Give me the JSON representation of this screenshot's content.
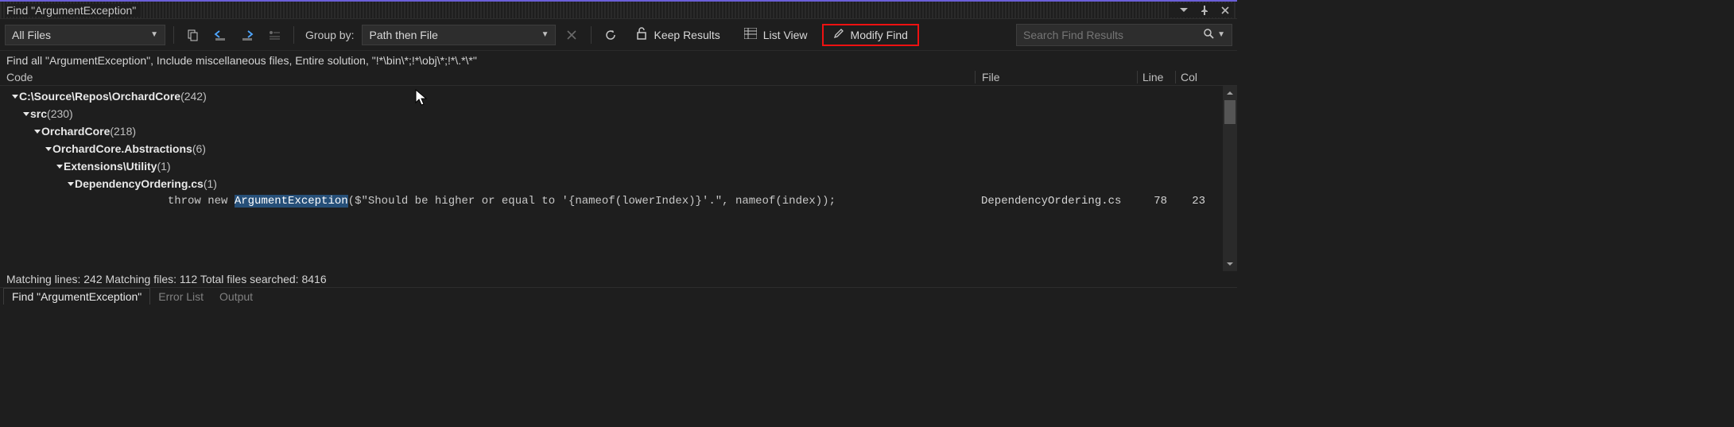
{
  "title": "Find \"ArgumentException\"",
  "toolbar": {
    "scope_selected": "All Files",
    "group_by_label": "Group by:",
    "group_by_selected": "Path then File",
    "keep_results": "Keep Results",
    "list_view": "List View",
    "modify_find": "Modify Find",
    "search_placeholder": "Search Find Results"
  },
  "query_summary": "Find all \"ArgumentException\", Include miscellaneous files, Entire solution, \"!*\\bin\\*;!*\\obj\\*;!*\\.*\\*\"",
  "columns": {
    "code": "Code",
    "file": "File",
    "line": "Line",
    "col": "Col"
  },
  "tree": [
    {
      "depth": 0,
      "label": "C:\\Source\\Repos\\OrchardCore",
      "count": "(242)"
    },
    {
      "depth": 1,
      "label": "src",
      "count": "(230)"
    },
    {
      "depth": 2,
      "label": "OrchardCore",
      "count": "(218)"
    },
    {
      "depth": 3,
      "label": "OrchardCore.Abstractions",
      "count": "(6)"
    },
    {
      "depth": 4,
      "label": "Extensions\\Utility",
      "count": "(1)"
    },
    {
      "depth": 5,
      "label": "DependencyOrdering.cs",
      "count": "(1)"
    }
  ],
  "code_row": {
    "prefix": "            throw new ",
    "highlight": "ArgumentException",
    "suffix": "($\"Should be higher or equal to '{nameof(lowerIndex)}'.\", nameof(index));",
    "file": "DependencyOrdering.cs",
    "line": "78",
    "col": "23"
  },
  "status": "Matching lines: 242 Matching files: 112 Total files searched: 8416",
  "bottom_tabs": {
    "active": "Find \"ArgumentException\"",
    "t2": "Error List",
    "t3": "Output"
  }
}
